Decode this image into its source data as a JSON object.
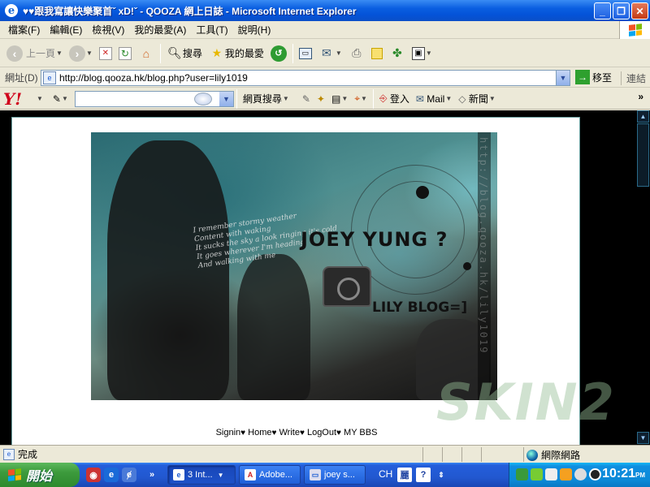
{
  "window": {
    "title": "♥♥跟我寫讓快樂聚首ˇ xD!ˇ - QOOZA 網上日誌 - Microsoft Internet Explorer",
    "minimize": "_",
    "maximize": "❐",
    "close": "✕"
  },
  "menu": {
    "items": [
      "檔案(F)",
      "編輯(E)",
      "檢視(V)",
      "我的最愛(A)",
      "工具(T)",
      "說明(H)"
    ]
  },
  "toolbar": {
    "back_label": "上一頁",
    "search_label": "搜尋",
    "favorites_label": "我的最愛"
  },
  "address": {
    "label": "網址(D)",
    "url": "http://blog.qooza.hk/blog.php?user=lily1019",
    "go_label": "移至",
    "links_label": "連結"
  },
  "yahoo_bar": {
    "logo": "Y!",
    "search_value": "",
    "web_search_label": "網頁搜尋",
    "signin_label": "登入",
    "mail_label": "Mail",
    "news_label": "新聞",
    "more": "»"
  },
  "page": {
    "banner": {
      "vertical_text": "http://blog.qooza.hk/lily1019",
      "headline": "JOEY YUNG ?",
      "sub": "LILY BLOG=]",
      "poem": "I remember stormy weather\nContent with waking\nIt sucks the sky a look ringing it's cold\nIt goes wherever I'm heading\nAnd walking with me",
      "watermark": "SKIN2"
    },
    "nav": [
      {
        "label": "Signin"
      },
      {
        "label": "Home"
      },
      {
        "label": "Write"
      },
      {
        "label": "LogOut"
      },
      {
        "label": "MY BBS"
      }
    ],
    "separator": "♥"
  },
  "status": {
    "text": "完成",
    "zone": "網際網路"
  },
  "taskbar": {
    "start_label": "開始",
    "tasks": [
      {
        "label": "3 Int...",
        "active": true
      },
      {
        "label": "Adobe...",
        "active": false
      },
      {
        "label": "joey s...",
        "active": false
      }
    ],
    "lang": "CH",
    "ime": "麗",
    "clock": "10:21",
    "clock_ampm": "PM"
  },
  "colors": {
    "titlebar": "#0453d8",
    "chrome": "#ece9d8",
    "page_bg": "#000000",
    "start_green": "#3c9a3c"
  }
}
